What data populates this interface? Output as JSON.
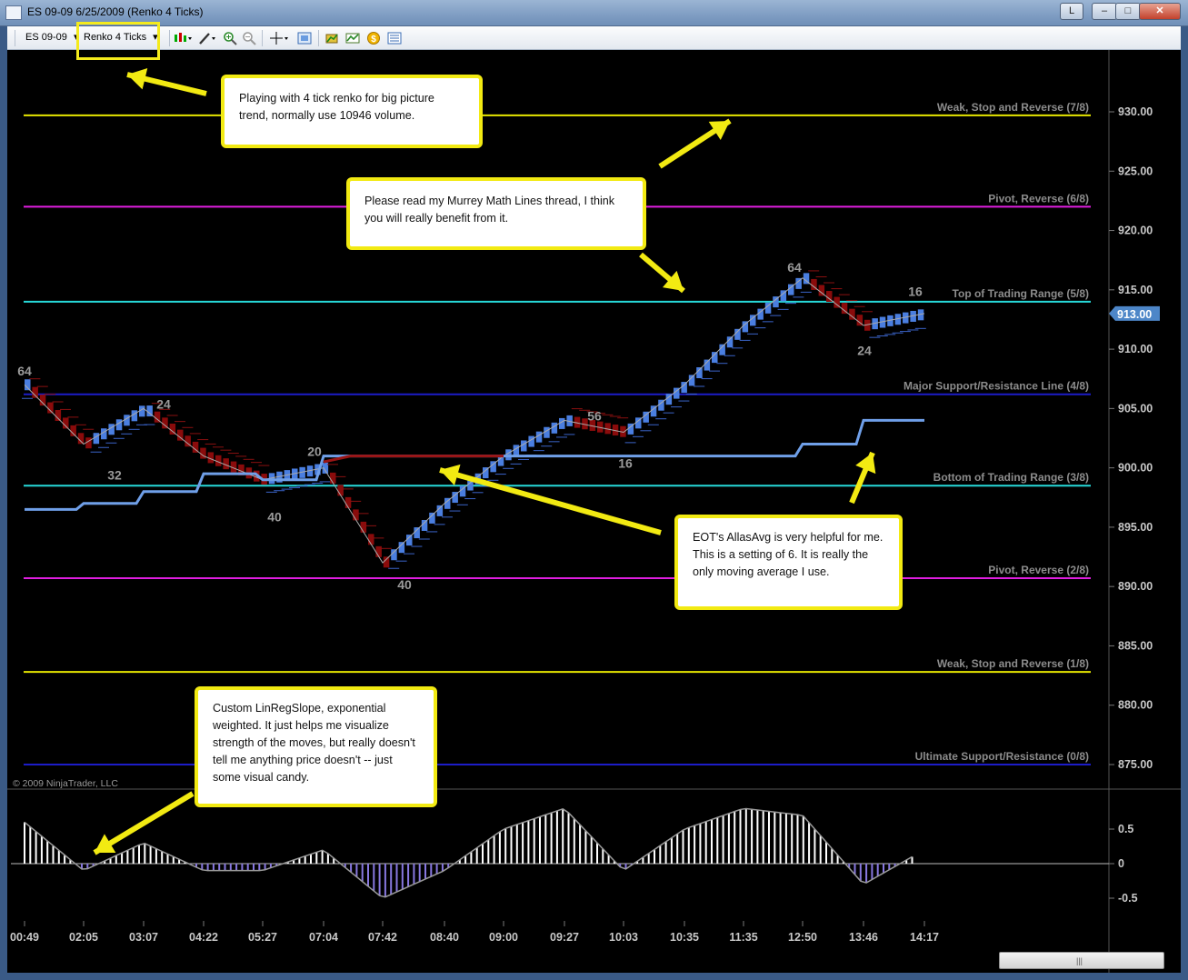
{
  "window": {
    "title": "ES 09-09  6/25/2009 (Renko 4 Ticks)",
    "l_label": "L",
    "minimize": "–",
    "maximize": "□",
    "close": "✕"
  },
  "toolbar": {
    "instrument": "ES 09-09",
    "period": "Renko 4 Ticks",
    "dropdown_glyph": "▾"
  },
  "chart": {
    "copyright": "© 2009 NinjaTrader, LLC",
    "current_price": "913.00",
    "price_ticks": [
      "930.00",
      "925.00",
      "920.00",
      "915.00",
      "910.00",
      "905.00",
      "900.00",
      "895.00",
      "890.00",
      "885.00",
      "880.00",
      "875.00"
    ],
    "indicator_ticks": [
      "0.5",
      "0",
      "-0.5"
    ],
    "time_ticks": [
      "00:49",
      "02:05",
      "03:07",
      "04:22",
      "05:27",
      "07:04",
      "07:42",
      "08:40",
      "09:00",
      "09:27",
      "10:03",
      "10:35",
      "11:35",
      "12:50",
      "13:46",
      "14:17"
    ],
    "murrey_lines": [
      {
        "label": "Weak, Stop and Reverse (7/8)",
        "price": 929.7,
        "color": "#e6e600"
      },
      {
        "label": "Pivot, Reverse (6/8)",
        "price": 922.0,
        "color": "#e01ee0"
      },
      {
        "label": "Top of Trading Range (5/8)",
        "price": 914.0,
        "color": "#27d9d9"
      },
      {
        "label": "Major Support/Resistance Line (4/8)",
        "price": 906.2,
        "color": "#1c1cc8"
      },
      {
        "label": "Bottom of Trading Range (3/8)",
        "price": 898.5,
        "color": "#27d9d9"
      },
      {
        "label": "Pivot, Reverse (2/8)",
        "price": 890.7,
        "color": "#e01ee0"
      },
      {
        "label": "Weak, Stop and Reverse (1/8)",
        "price": 882.8,
        "color": "#e6e600"
      },
      {
        "label": "Ultimate Support/Resistance (0/8)",
        "price": 875.0,
        "color": "#1c1cc8"
      }
    ],
    "swing_labels": [
      "64",
      "32",
      "24",
      "40",
      "20",
      "40",
      "56",
      "16",
      "64",
      "24",
      "16"
    ],
    "colors": {
      "up": "#4a7ee0",
      "down": "#8a0b0b",
      "avg": "#6f9fe8",
      "avg_red": "#9a1414",
      "slope_pos": "#ffffff",
      "slope_neg": "#8878e0"
    }
  },
  "chart_data": {
    "type": "line",
    "title": "ES 09-09  6/25/2009 (Renko 4 Ticks)",
    "xlabel": "",
    "ylabel": "",
    "ylim": [
      871,
      933
    ],
    "x": [
      "00:49",
      "02:05",
      "03:07",
      "04:22",
      "05:27",
      "07:04",
      "07:42",
      "08:40",
      "09:00",
      "09:27",
      "10:03",
      "10:35",
      "11:35",
      "12:50",
      "13:46",
      "14:17"
    ],
    "series": [
      {
        "values": [
          907,
          902,
          905,
          901,
          899,
          900,
          892,
          897,
          901,
          904,
          903,
          907,
          912,
          916,
          912,
          913
        ]
      },
      {
        "values": [
          896.5,
          897,
          898,
          899.5,
          899,
          901,
          901,
          901,
          901,
          901,
          901,
          901,
          901,
          902,
          904,
          904
        ]
      }
    ],
    "indicator": {
      "ylim": [
        -0.8,
        0.9
      ],
      "values": [
        0.6,
        -0.1,
        0.3,
        -0.1,
        -0.1,
        0.2,
        -0.5,
        -0.1,
        0.5,
        0.8,
        -0.1,
        0.5,
        0.8,
        0.7,
        -0.3,
        0.2
      ]
    }
  },
  "annotations": {
    "note1": "Playing with 4 tick renko for big picture trend, normally use 10946 volume.",
    "note2": "Please read my Murrey Math Lines thread, I think you will really benefit from it.",
    "note3": "EOT's AllasAvg is very helpful for me.  This is a setting of 6.  It is really the only moving average I use.",
    "note4": "Custom LinRegSlope, exponential weighted.  It just helps me visualize strength of the moves, but really doesn't tell me anything price doesn't -- just some visual candy."
  },
  "scrollbar": {
    "grip": "|||"
  }
}
